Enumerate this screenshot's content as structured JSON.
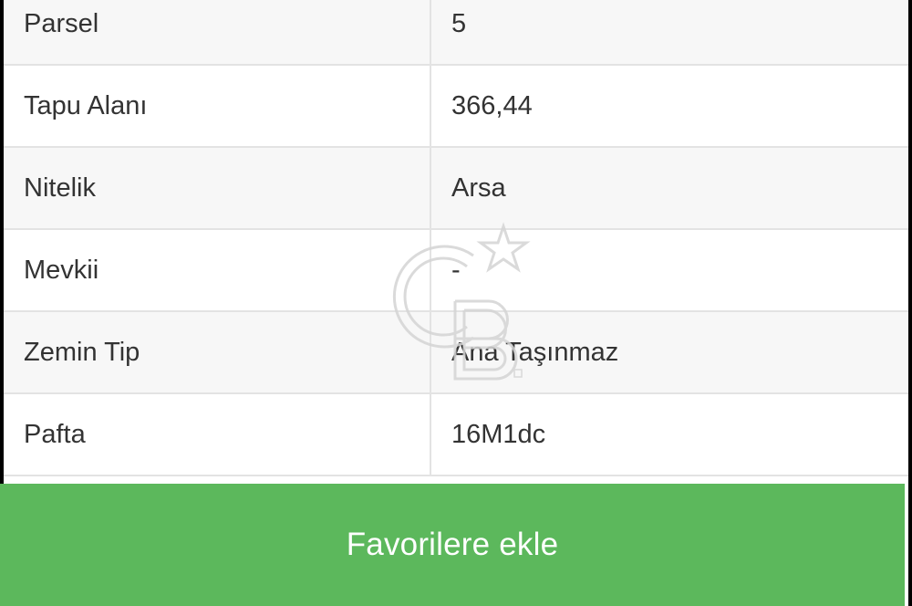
{
  "table": {
    "rows": [
      {
        "label": "Parsel",
        "value": "5"
      },
      {
        "label": "Tapu Alanı",
        "value": "366,44"
      },
      {
        "label": "Nitelik",
        "value": "Arsa"
      },
      {
        "label": "Mevkii",
        "value": "-"
      },
      {
        "label": "Zemin Tip",
        "value": "Ana Taşınmaz"
      },
      {
        "label": "Pafta",
        "value": "16M1dc"
      }
    ]
  },
  "button": {
    "favorite_label": "Favorilere ekle"
  },
  "watermark": {
    "icon": "cb-logo-watermark-icon"
  },
  "colors": {
    "accent": "#5cb85c",
    "text": "#333333",
    "divider": "#e3e3e3"
  }
}
